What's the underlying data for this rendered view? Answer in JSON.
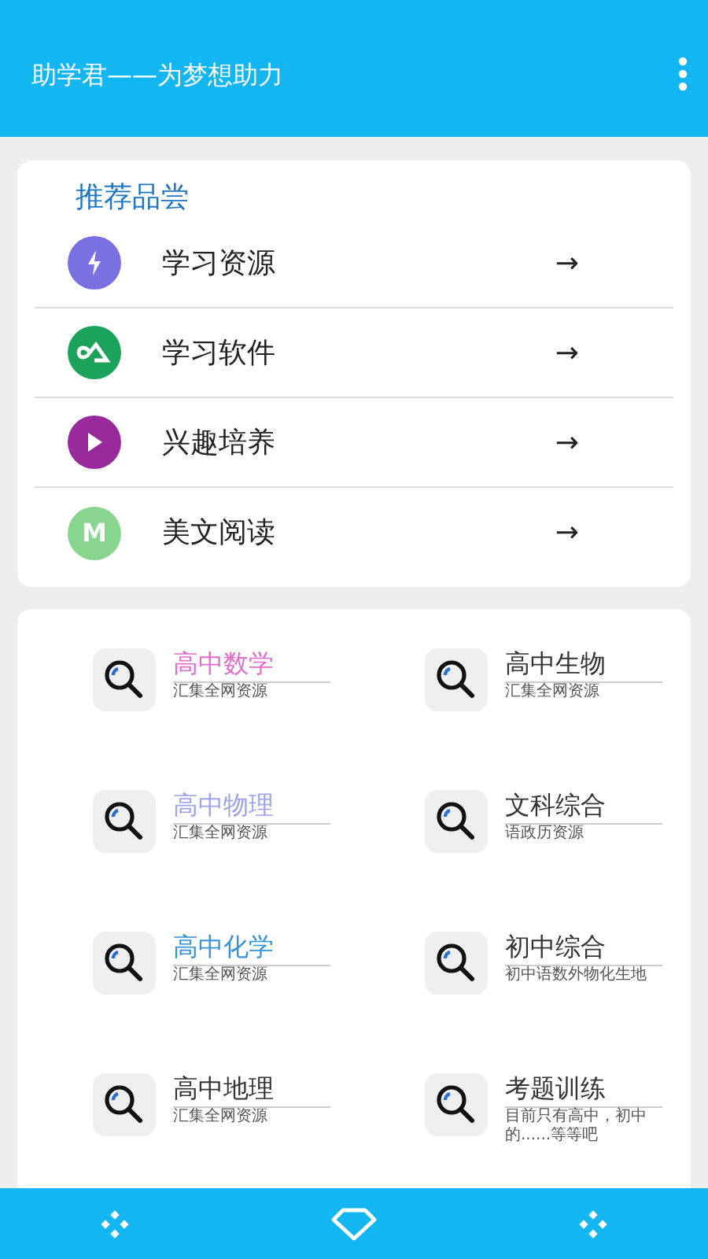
{
  "app_bar": {
    "title": "助学君——为梦想助力"
  },
  "recommend": {
    "heading": "推荐品尝",
    "items": [
      {
        "label": "学习资源",
        "arrow": "→",
        "kind": "bolt",
        "color": "#7b70e2"
      },
      {
        "label": "学习软件",
        "arrow": "→",
        "kind": "loop",
        "color": "#1ba35b"
      },
      {
        "label": "兴趣培养",
        "arrow": "→",
        "kind": "play",
        "color": "#982a9c"
      },
      {
        "label": "美文阅读",
        "arrow": "→",
        "kind": "letter",
        "letter": "M",
        "color": "#88d58e"
      }
    ]
  },
  "subjects": [
    {
      "title": "高中数学",
      "subtitle": "汇集全网资源",
      "color": "#e46ccb"
    },
    {
      "title": "高中生物",
      "subtitle": "汇集全网资源",
      "color": "#333333"
    },
    {
      "title": "高中物理",
      "subtitle": "汇集全网资源",
      "color": "#9ea2ea"
    },
    {
      "title": "文科综合",
      "subtitle": "语政历资源",
      "color": "#333333"
    },
    {
      "title": "高中化学",
      "subtitle": "汇集全网资源",
      "color": "#3592d8"
    },
    {
      "title": "初中综合",
      "subtitle": "初中语数外物化生地",
      "color": "#333333"
    },
    {
      "title": "高中地理",
      "subtitle": "汇集全网资源",
      "color": "#333333"
    },
    {
      "title": "考题训练",
      "subtitle": "目前只有高中，初中的......等等吧",
      "color": "#333333"
    }
  ]
}
